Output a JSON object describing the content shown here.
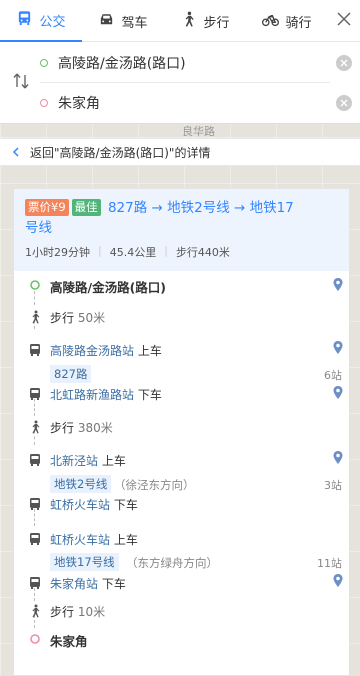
{
  "tabs": [
    {
      "label": "公交",
      "icon": "bus-icon",
      "active": true
    },
    {
      "label": "驾车",
      "icon": "car-icon",
      "active": false
    },
    {
      "label": "步行",
      "icon": "walk-icon",
      "active": false
    },
    {
      "label": "骑行",
      "icon": "bike-icon",
      "active": false
    }
  ],
  "search": {
    "origin": "高陵路/金汤路(路口)",
    "destination": "朱家角"
  },
  "map": {
    "label": "良华路"
  },
  "back_link": "返回\"高陵路/金汤路(路口)\"的详情",
  "route": {
    "price_tag": "票价¥9",
    "best_tag": "最佳",
    "summary": "827路 → 地铁2号线 → 地铁17号线",
    "summary_line1": "827路 → 地铁2号线 → 地铁17",
    "summary_line2": "号线",
    "duration": "1小时29分钟",
    "distance": "45.4公里",
    "walk": "步行440米"
  },
  "steps": {
    "origin": "高陵路/金汤路(路口)",
    "walk1_label": "步行",
    "walk1_dist": "50米",
    "board1_station": "高陵路金汤路站",
    "board1_action": "上车",
    "line1": "827路",
    "line1_stops": "6站",
    "alight1_station": "北虹路新渔路站",
    "alight1_action": "下车",
    "walk2_label": "步行",
    "walk2_dist": "380米",
    "board2_station": "北新泾站",
    "board2_action": "上车",
    "line2": "地铁2号线",
    "line2_dir": "（徐泾东方向）",
    "line2_stops": "3站",
    "alight2_station": "虹桥火车站",
    "alight2_action": "下车",
    "board3_station": "虹桥火车站",
    "board3_action": "上车",
    "line3": "地铁17号线",
    "line3_dir": "（东方绿舟方向）",
    "line3_stops": "11站",
    "alight3_station": "朱家角站",
    "alight3_action": "下车",
    "walk3_label": "步行",
    "walk3_dist": "10米",
    "destination": "朱家角"
  },
  "colors": {
    "accent": "#3385ff",
    "price": "#f5845b",
    "best": "#51b57a",
    "start": "#6cc26b",
    "end": "#f08fa3"
  }
}
